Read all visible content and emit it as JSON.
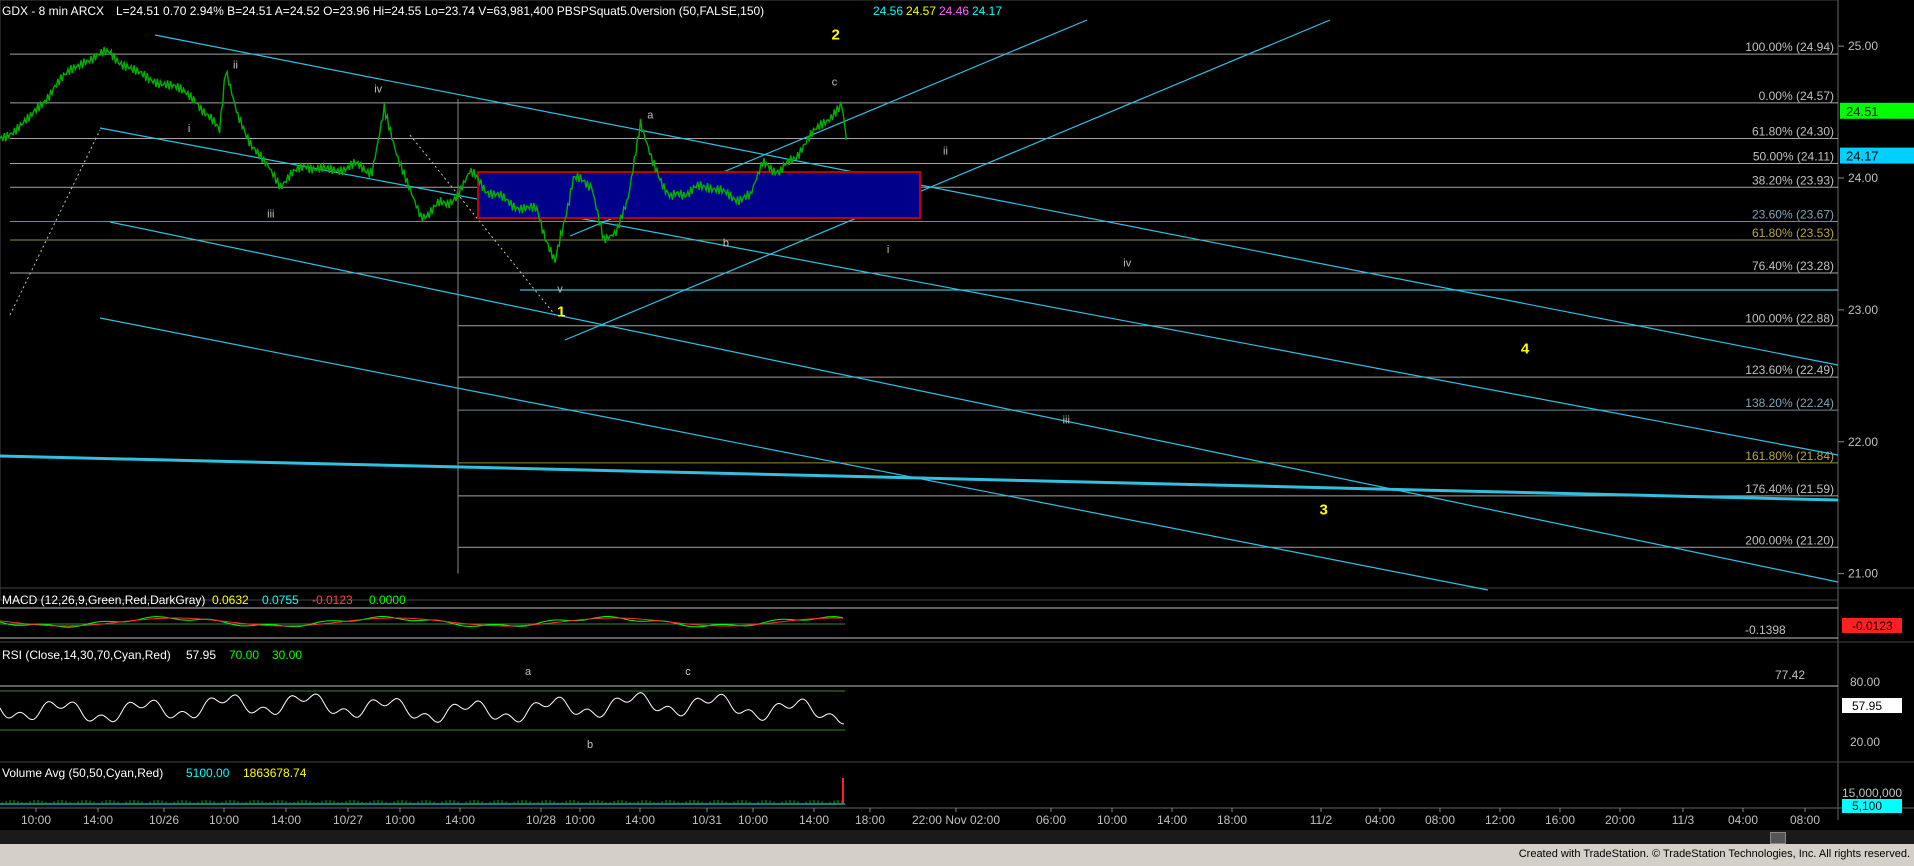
{
  "header": {
    "symbol": "GDX - 8 min  ARCX",
    "quote": "L=24.51  0.70  2.94%  B=24.51  A=24.52  O=23.96  Hi=24.55  Lo=23.74  V=63,981,400  PBSPSquat5.0version (50,FALSE,150)",
    "ind_values": [
      {
        "text": "24.56",
        "color": "#00ffff"
      },
      {
        "text": "24.57",
        "color": "#ffff00"
      },
      {
        "text": "24.46",
        "color": "#ff66ff"
      },
      {
        "text": "24.17",
        "color": "#00ffff"
      }
    ]
  },
  "chart_data": {
    "type": "line",
    "price_axis": {
      "ylim": [
        20.8,
        25.35
      ],
      "ticks": [
        "25.00",
        "24.00",
        "23.00",
        "22.00",
        "21.00"
      ]
    },
    "price_series": [
      [
        0,
        24.3
      ],
      [
        25,
        24.45
      ],
      [
        45,
        24.7
      ],
      [
        70,
        24.9
      ],
      [
        90,
        24.95
      ],
      [
        110,
        24.8
      ],
      [
        135,
        24.72
      ],
      [
        160,
        24.6
      ],
      [
        180,
        24.35
      ],
      [
        185,
        24.8
      ],
      [
        195,
        24.45
      ],
      [
        210,
        24.2
      ],
      [
        220,
        24.1
      ],
      [
        230,
        23.95
      ],
      [
        250,
        24.1
      ],
      [
        270,
        24.05
      ],
      [
        290,
        24.1
      ],
      [
        305,
        24.05
      ],
      [
        315,
        24.55
      ],
      [
        325,
        24.2
      ],
      [
        335,
        23.95
      ],
      [
        345,
        23.7
      ],
      [
        360,
        23.8
      ],
      [
        375,
        23.85
      ],
      [
        385,
        24.05
      ],
      [
        400,
        23.9
      ],
      [
        420,
        23.8
      ],
      [
        440,
        23.75
      ],
      [
        455,
        23.35
      ],
      [
        470,
        24.0
      ],
      [
        485,
        23.95
      ],
      [
        495,
        23.55
      ],
      [
        505,
        23.6
      ],
      [
        515,
        23.85
      ],
      [
        525,
        24.4
      ],
      [
        535,
        24.1
      ],
      [
        550,
        23.85
      ],
      [
        565,
        23.9
      ],
      [
        580,
        23.95
      ],
      [
        600,
        23.85
      ],
      [
        615,
        23.85
      ],
      [
        625,
        24.1
      ],
      [
        640,
        24.05
      ],
      [
        655,
        24.2
      ],
      [
        668,
        24.35
      ],
      [
        680,
        24.45
      ],
      [
        690,
        24.55
      ],
      [
        695,
        24.2
      ]
    ],
    "x_tick_labels": [
      "10:00",
      "14:00",
      "10/26",
      "10:00",
      "14:00",
      "10/27",
      "10:00",
      "14:00",
      "10/28",
      "10:00",
      "14:00",
      "10/31",
      "10:00",
      "14:00",
      "18:00",
      "22:00 Nov 02:00",
      "06:00",
      "10:00",
      "14:00",
      "18:00",
      "11/2",
      "04:00",
      "08:00",
      "12:00",
      "16:00",
      "20:00",
      "11/3",
      "04:00",
      "08:00"
    ],
    "fib_levels": [
      {
        "label": "100.00% (24.94)",
        "value": 24.94,
        "color": "#c0c0c0"
      },
      {
        "label": "0.00% (24.57)",
        "value": 24.57,
        "color": "#c0c0c0"
      },
      {
        "label": "61.80% (24.30)",
        "value": 24.3,
        "color": "#c0c0c0"
      },
      {
        "label": "50.00% (24.11)",
        "value": 24.11,
        "color": "#c0c0c0"
      },
      {
        "label": "38.20% (23.93)",
        "value": 23.93,
        "color": "#c0c0c0"
      },
      {
        "label": "23.60% (23.67)",
        "value": 23.67,
        "color": "#7fa3b8"
      },
      {
        "label": "61.80% (23.53)",
        "value": 23.53,
        "color": "#b5a642"
      },
      {
        "label": "76.40% (23.28)",
        "value": 23.28,
        "color": "#c0c0c0"
      },
      {
        "label": "100.00% (22.88)",
        "value": 22.88,
        "color": "#c0c0c0"
      },
      {
        "label": "123.60% (22.49)",
        "value": 22.49,
        "color": "#c0c0c0"
      },
      {
        "label": "138.20% (22.24)",
        "value": 22.24,
        "color": "#7fa3b8"
      },
      {
        "label": "161.80% (21.84)",
        "value": 21.84,
        "color": "#b5a642"
      },
      {
        "label": "176.40% (21.59)",
        "value": 21.59,
        "color": "#c0c0c0"
      },
      {
        "label": "200.00% (21.20)",
        "value": 21.2,
        "color": "#c0c0c0"
      }
    ],
    "price_badges": [
      {
        "text": "24.51",
        "color": "#00ff00",
        "value": 24.51
      },
      {
        "text": "24.17",
        "color": "#00cfff",
        "value": 24.17
      }
    ],
    "wave_labels": [
      {
        "text": "2",
        "color": "#ffff00",
        "x": 685,
        "y": 25.05,
        "bold": true
      },
      {
        "text": "1",
        "color": "#ffff00",
        "x": 460,
        "y": 22.95,
        "bold": true
      },
      {
        "text": "4",
        "color": "#ffff00",
        "x": 1250,
        "y": 22.67,
        "bold": true
      },
      {
        "text": "3",
        "color": "#ffff00",
        "x": 1085,
        "y": 21.45,
        "bold": true
      },
      {
        "text": "ii",
        "color": "#c0c0c0",
        "x": 193,
        "y": 24.83
      },
      {
        "text": "i",
        "color": "#c0c0c0",
        "x": 155,
        "y": 24.35
      },
      {
        "text": "iii",
        "color": "#c0c0c0",
        "x": 222,
        "y": 23.7
      },
      {
        "text": "iv",
        "color": "#c0c0c0",
        "x": 310,
        "y": 24.65
      },
      {
        "text": "v",
        "color": "#c0c0c0",
        "x": 459,
        "y": 23.13
      },
      {
        "text": "a",
        "color": "#c0c0c0",
        "x": 533,
        "y": 24.45
      },
      {
        "text": "b",
        "color": "#c0c0c0",
        "x": 595,
        "y": 23.48
      },
      {
        "text": "c",
        "color": "#c0c0c0",
        "x": 684,
        "y": 24.7
      },
      {
        "text": "ii",
        "color": "#c0c0c0",
        "x": 775,
        "y": 24.18
      },
      {
        "text": "i",
        "color": "#c0c0c0",
        "x": 728,
        "y": 23.43
      },
      {
        "text": "iv",
        "color": "#c0c0c0",
        "x": 924,
        "y": 23.33
      },
      {
        "text": "iii",
        "color": "#c0c0c0",
        "x": 874,
        "y": 22.14
      }
    ],
    "macd": {
      "label": "MACD (12,26,9,Green,Red,DarkGray)",
      "values": [
        {
          "text": "0.0632",
          "color": "#ffff00"
        },
        {
          "text": "0.0755",
          "color": "#00ffff"
        },
        {
          "text": "-0.0123",
          "color": "#ff4040"
        },
        {
          "text": "0.0000",
          "color": "#00ff00"
        }
      ],
      "axis_value": "-0.1398",
      "badge": "-0.0123"
    },
    "rsi": {
      "label": "RSI (Close,14,30,70,Cyan,Red)",
      "values": [
        {
          "text": "57.95",
          "color": "#ffffff"
        },
        {
          "text": "70.00",
          "color": "#00ff00"
        },
        {
          "text": "30.00",
          "color": "#00ff00"
        }
      ],
      "ticks": [
        "80.00",
        "20.00"
      ],
      "axis_value": "77.42",
      "badge": "57.95",
      "labels": [
        {
          "text": "a",
          "x": 528
        },
        {
          "text": "c",
          "x": 688
        },
        {
          "text": "b",
          "x": 590
        }
      ]
    },
    "volume": {
      "label": "Volume Avg (50,50,Cyan,Red)",
      "values": [
        {
          "text": "5100.00",
          "color": "#00ffff"
        },
        {
          "text": "1863678.74",
          "color": "#ffff00"
        }
      ],
      "tick": "15,000,000",
      "badge": "5,100"
    }
  },
  "footer": {
    "credit": "Created with TradeStation. © TradeStation Technologies, Inc. All rights reserved."
  }
}
